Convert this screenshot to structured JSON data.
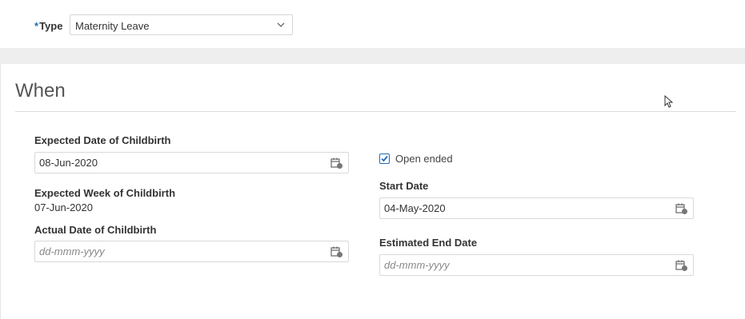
{
  "type_field": {
    "required_marker": "*",
    "label": "Type",
    "selected": "Maternity Leave"
  },
  "when_section": {
    "title": "When"
  },
  "left_column": {
    "expected_date": {
      "label": "Expected Date of Childbirth",
      "value": "08-Jun-2020",
      "placeholder": ""
    },
    "expected_week": {
      "label": "Expected Week of Childbirth",
      "value": "07-Jun-2020"
    },
    "actual_date": {
      "label": "Actual Date of Childbirth",
      "value": "",
      "placeholder": "dd-mmm-yyyy"
    }
  },
  "right_column": {
    "open_ended": {
      "label": "Open ended",
      "checked": true
    },
    "start_date": {
      "label": "Start Date",
      "value": "04-May-2020",
      "placeholder": ""
    },
    "estimated_end_date": {
      "label": "Estimated End Date",
      "value": "",
      "placeholder": "dd-mmm-yyyy"
    }
  },
  "icons": {
    "calendar": "calendar-icon",
    "chevron": "chevron-down-icon",
    "checkmark": "checkmark-icon",
    "cursor": "mouse-pointer-icon"
  },
  "colors": {
    "accent": "#1f6bb7",
    "band": "#eeeeee",
    "border": "#d9d9d9"
  }
}
